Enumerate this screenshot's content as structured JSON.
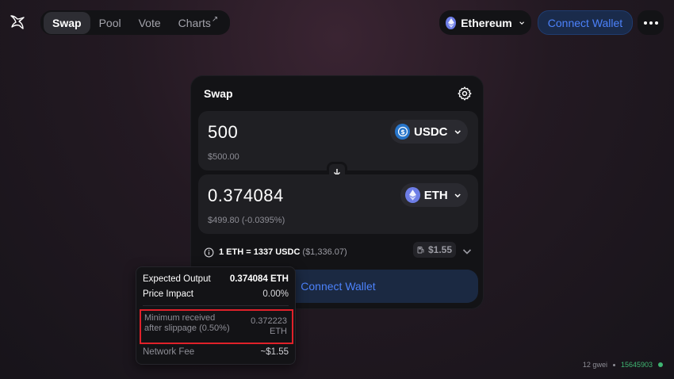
{
  "nav": {
    "items": [
      {
        "label": "Swap"
      },
      {
        "label": "Pool"
      },
      {
        "label": "Vote"
      },
      {
        "label": "Charts",
        "suffix": "↗"
      }
    ]
  },
  "header": {
    "chain": "Ethereum",
    "connect_label": "Connect Wallet"
  },
  "swap": {
    "title": "Swap",
    "input": {
      "amount": "500",
      "usd": "$500.00",
      "token": "USDC"
    },
    "output": {
      "amount": "0.374084",
      "usd": "$499.80 (-0.0395%)",
      "token": "ETH"
    },
    "rate": "1 ETH = 1337 USDC",
    "rate_usd": "($1,336.07)",
    "gas_fee": "$1.55",
    "connect_label": "Connect Wallet"
  },
  "tooltip": {
    "expected_output_label": "Expected Output",
    "expected_output_value": "0.374084 ETH",
    "price_impact_label": "Price Impact",
    "price_impact_value": "0.00%",
    "min_received_label": "Minimum received after slippage (0.50%)",
    "min_received_value": "0.372223 ETH",
    "network_fee_label": "Network Fee",
    "network_fee_value": "~$1.55"
  },
  "footer": {
    "gas": "12 gwei",
    "block": "15645903"
  },
  "colors": {
    "accent": "#4c82fb",
    "highlight": "#e0212a",
    "live": "#3fb672"
  }
}
